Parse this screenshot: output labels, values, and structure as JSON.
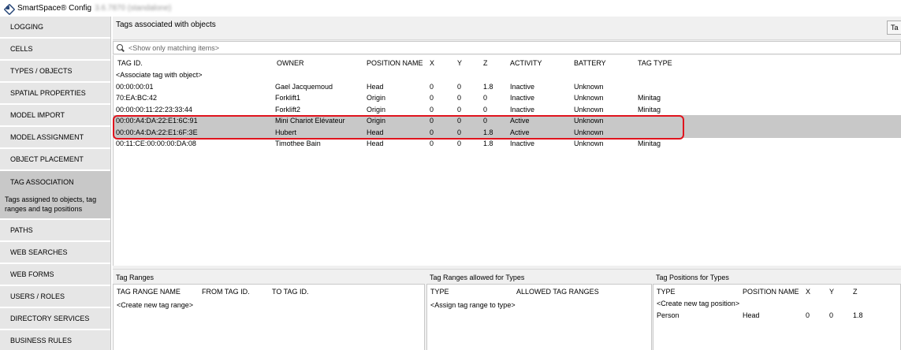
{
  "window": {
    "title": "SmartSpace® Config",
    "version": "3.6.7870 (standalone)"
  },
  "sidebar": {
    "items": [
      {
        "label": "LOGGING"
      },
      {
        "label": "CELLS"
      },
      {
        "label": "TYPES / OBJECTS"
      },
      {
        "label": "SPATIAL PROPERTIES"
      },
      {
        "label": "MODEL IMPORT"
      },
      {
        "label": "MODEL ASSIGNMENT"
      },
      {
        "label": "OBJECT PLACEMENT"
      },
      {
        "label": "TAG ASSOCIATION",
        "active": true
      },
      {
        "label": "PATHS"
      },
      {
        "label": "WEB SEARCHES"
      },
      {
        "label": "WEB FORMS"
      },
      {
        "label": "USERS / ROLES"
      },
      {
        "label": "DIRECTORY SERVICES"
      },
      {
        "label": "BUSINESS RULES"
      }
    ],
    "active_description": "Tags assigned to objects, tag ranges and tag positions"
  },
  "main": {
    "title": "Tags associated with objects",
    "top_right_button": "Ta",
    "search_placeholder": "<Show only matching items>",
    "columns": [
      "TAG ID.",
      "OWNER",
      "POSITION NAME",
      "X",
      "Y",
      "Z",
      "ACTIVITY",
      "BATTERY",
      "TAG TYPE"
    ],
    "create_row": "<Associate tag with object>",
    "rows": [
      {
        "tag_id": "00:00:00:01",
        "owner": "Gael Jacquemoud",
        "position": "Head",
        "x": "0",
        "y": "0",
        "z": "1.8",
        "activity": "Inactive",
        "battery": "Unknown",
        "tag_type": ""
      },
      {
        "tag_id": "70:EA:BC:42",
        "owner": "Forklift1",
        "position": "Origin",
        "x": "0",
        "y": "0",
        "z": "0",
        "activity": "Inactive",
        "battery": "Unknown",
        "tag_type": "Minitag"
      },
      {
        "tag_id": "00:00:00:11:22:23:33:44",
        "owner": "Forklift2",
        "position": "Origin",
        "x": "0",
        "y": "0",
        "z": "0",
        "activity": "Inactive",
        "battery": "Unknown",
        "tag_type": "Minitag"
      },
      {
        "tag_id": "00:00:A4:DA:22:E1:6C:91",
        "owner": "Mini Chariot Elévateur",
        "position": "Origin",
        "x": "0",
        "y": "0",
        "z": "0",
        "activity": "Active",
        "battery": "Unknown",
        "tag_type": ""
      },
      {
        "tag_id": "00:00:A4:DA:22:E1:6F:3E",
        "owner": "Hubert",
        "position": "Head",
        "x": "0",
        "y": "0",
        "z": "1.8",
        "activity": "Active",
        "battery": "Unknown",
        "tag_type": ""
      },
      {
        "tag_id": "00:11:CE:00:00:00:DA:08",
        "owner": "Timothee Bain",
        "position": "Head",
        "x": "0",
        "y": "0",
        "z": "1.8",
        "activity": "Inactive",
        "battery": "Unknown",
        "tag_type": "Minitag"
      }
    ],
    "highlight_color": "#e0141e",
    "selection_color": "#c8c8c8"
  },
  "tag_ranges": {
    "title": "Tag Ranges",
    "columns": [
      "TAG RANGE NAME",
      "FROM TAG ID.",
      "TO TAG ID."
    ],
    "create_row": "<Create new tag range>"
  },
  "ranges_for_types": {
    "title": "Tag Ranges allowed for Types",
    "columns": [
      "TYPE",
      "ALLOWED TAG RANGES"
    ],
    "create_row": "<Assign tag range to type>"
  },
  "positions_for_types": {
    "title": "Tag Positions for Types",
    "columns": [
      "TYPE",
      "POSITION NAME",
      "X",
      "Y",
      "Z"
    ],
    "create_row": "<Create new tag position>",
    "rows": [
      {
        "type": "Person",
        "position": "Head",
        "x": "0",
        "y": "0",
        "z": "1.8"
      }
    ]
  }
}
